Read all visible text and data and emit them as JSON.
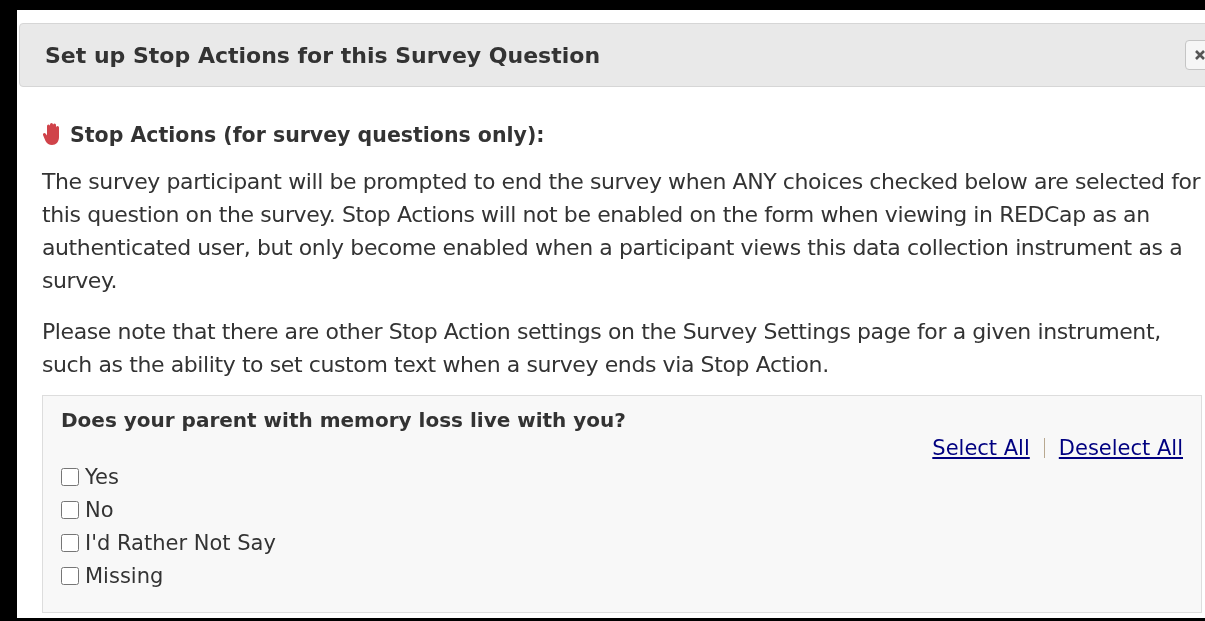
{
  "dialog": {
    "title": "Set up Stop Actions for this Survey Question"
  },
  "section": {
    "heading": "Stop Actions (for survey questions only):",
    "paragraphs": [
      "The survey participant will be prompted to end the survey when ANY choices checked below are selected for this question on the survey. Stop Actions will not be enabled on the form when viewing in REDCap as an authenticated user, but only become enabled when a participant views this data collection instrument as a survey.",
      "Please note that there are other Stop Action settings on the Survey Settings page for a given instrument, such as the ability to set custom text when a survey ends via Stop Action."
    ]
  },
  "question": {
    "label": "Does your parent with memory loss live with you?",
    "links": [
      "Select All",
      "Deselect All"
    ],
    "choices": [
      {
        "label": "Yes",
        "checked": false
      },
      {
        "label": "No",
        "checked": false
      },
      {
        "label": "I'd Rather Not Say",
        "checked": false
      },
      {
        "label": "Missing",
        "checked": false
      }
    ]
  }
}
